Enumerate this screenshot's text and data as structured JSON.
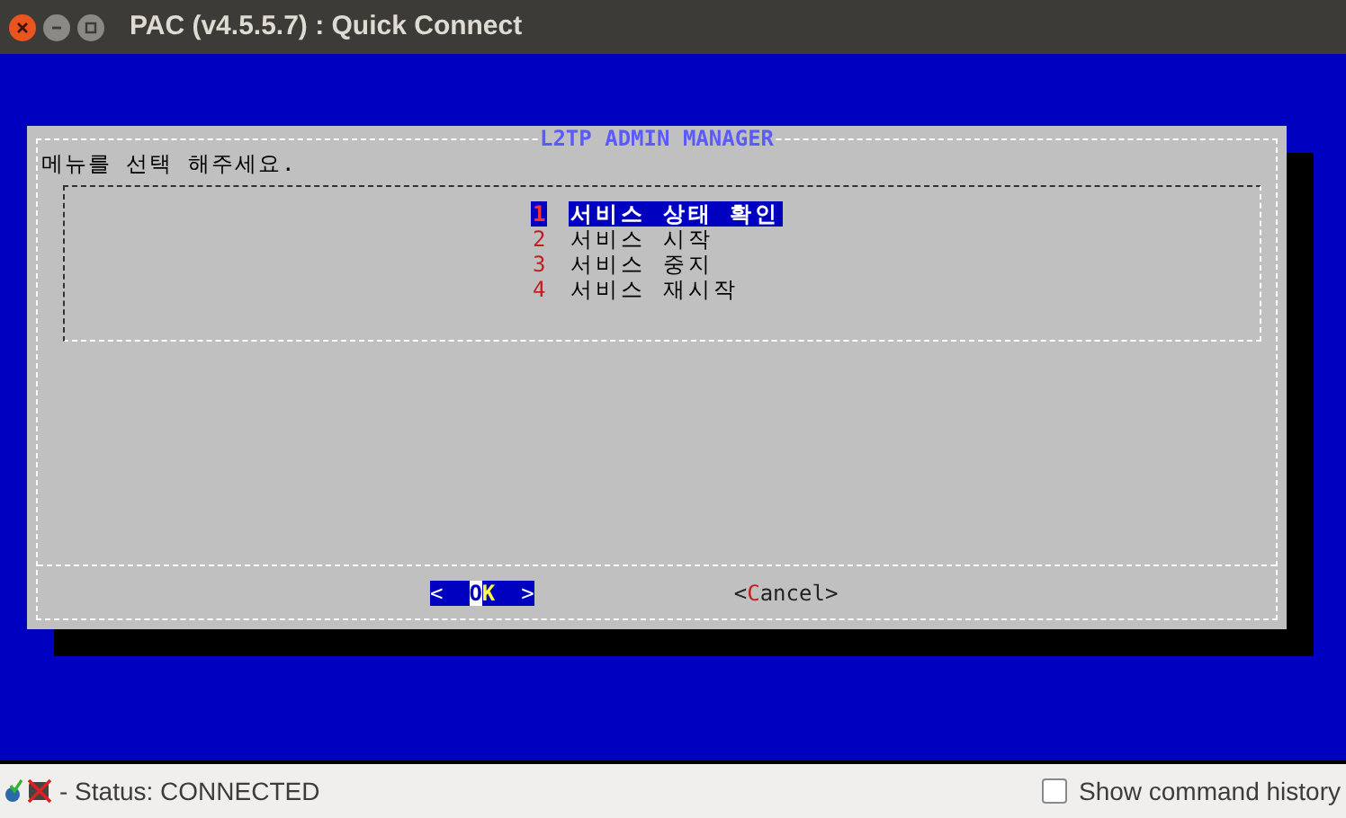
{
  "window": {
    "title": "PAC (v4.5.5.7) : Quick Connect"
  },
  "dialog": {
    "title": "L2TP ADMIN MANAGER",
    "prompt": "메뉴를 선택 해주세요.",
    "items": [
      {
        "tag": "1",
        "label": "서비스 상태 확인",
        "selected": true
      },
      {
        "tag": "2",
        "label": "서비스 시작",
        "selected": false
      },
      {
        "tag": "3",
        "label": "서비스 중지",
        "selected": false
      },
      {
        "tag": "4",
        "label": "서비스 재시작",
        "selected": false
      }
    ],
    "buttons": [
      {
        "open": "<",
        "hotkey": "O",
        "rest": "K",
        "close": ">",
        "selected": true
      },
      {
        "open": "<",
        "hotkey": "C",
        "rest": "ancel",
        "close": ">",
        "selected": false
      }
    ]
  },
  "status_bar": {
    "status": "- Status: CONNECTED",
    "history": {
      "label": "Show command history",
      "checked": false
    }
  }
}
